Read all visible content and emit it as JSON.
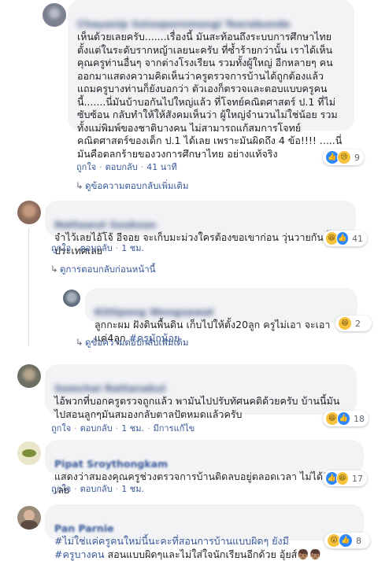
{
  "labels": {
    "like": "ถูกใจ",
    "reply": "ตอบกลับ",
    "edited": "มีการแก้ไข",
    "separator": "·"
  },
  "comments": [
    {
      "name": "Chayanip Soisopornmongi Teerabunde",
      "text": "เห็นด้วยเลยครับ.......เรื่องนี้ มันสะท้อนถึงระบบการศึกษาไทยตั้งแต่ในระดับรากหญ้าเลยนะครับ ที่ซ้ำร้ายกว่านั้น เราได้เห็นคุณครูท่านอื่นๆ จากต่างโรงเรียน รวมทั้งผู้ใหญ่ อีกหลายๆ คน ออกมาแสดงความคิดเห็นว่าครูตรวจการบ้านได้ถูกต้องแล้ว แถมครูบางท่านก็ยังบอกว่า ตัวเองก็ตรวจและตอบแบบครูคนนี้.......นี่มันบ้าบอกันไปใหญ่แล้ว ที่โจทย์คณิตศาสตร์ ป.1 ที่ไม่ซับซ้อน กลับทำให้ให้สังคมเห็นว่า ผู้ใหญ่จำนวนไม่ใช่น้อย รวมทั้งแม่พิมพ์ของชาติบางคน ไม่สามารถแก้สมการโจทย์คณิตศาสตร์ของเด็ก ป.1 ได้เลย เพราะมันผิดถึง 4 ข้อ!!!! .....นี่มันคือตลกร้ายของวงการศึกษาไทย อย่างแท้จริง",
      "time": "41 นาที",
      "reactions": "9",
      "thread": "ดูข้อความตอบกลับเพิ่มเติม"
    },
    {
      "name": "Nattawut Sooksan",
      "text": "จำไว้เลยไอ้โจ้ อีจอย จะเก็บมะม่วงใครต้องขอเขาก่อน วุ่นวายกันทั้งประเทศเลย",
      "time": "1 ชม.",
      "reactions": "41",
      "thread": "ดูการตอบกลับก่อนหน้านี้"
    },
    {
      "name": "Kittipong Wongsawat",
      "text_pre": "ลูกกะผม ฝังดินพื้นดิน เก็บไปให้ตั้ง20ลูก ครูไม่เอา จะเอาแค่4ลูก ",
      "hashtag": "#ครูมักน้อย",
      "reactions": "2",
      "thread": "ดูข้อความตอบกลับเพิ่มเติม"
    },
    {
      "name": "Somchai Rattanakul",
      "text": "ไอ้พวกที่บอกครูตรวจถูกแล้ว พามันไปปรับทัศนคติด้วยครับ บ้านนี้มันไปสอนลูกๆมันสมองกลับตาลปัตหมดแล้วครับ",
      "time": "1 ชม.",
      "edited": true,
      "reactions": "18"
    },
    {
      "name": "Pipat Sroythongkam",
      "text": "แสดงว่าสมองคุณครูช่วงตรวจการบ้านติดลบอยู่ตลอดเวลา ไม่ได้คิดบวกเลย",
      "time": "1 ชม.",
      "reactions": "17"
    },
    {
      "name": "Pan Parnie",
      "text_a": "#ไม่ใช่แค่ครูคนใหม่นี้นะคะที่สอนการบ้านแบบผิดๆ ยังมี",
      "text_b": "#ครูบางคน",
      "text_c": " สอนแบบผิดๆและไม่ใส่ใจนักเรียนอีกด้วย อุ้ยส์👦🏽👦🏽",
      "reactions": "8"
    }
  ],
  "colors": {
    "link": "#385898",
    "bubble": "#f2f3f5",
    "like_blue": "#2d88ff",
    "emoji_yellow": "#f7c33d"
  }
}
